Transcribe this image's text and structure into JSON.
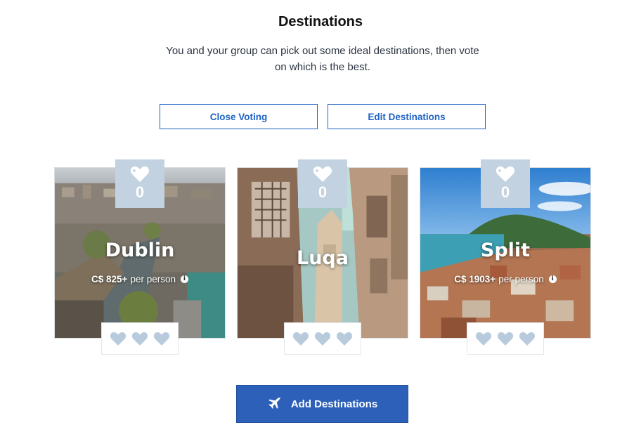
{
  "header": {
    "title": "Destinations",
    "subtitle": "You and your group can pick out some ideal destinations, then vote on which is the best."
  },
  "actions": {
    "close_voting": "Close Voting",
    "edit_destinations": "Edit Destinations",
    "add_destinations": "Add Destinations"
  },
  "destinations": [
    {
      "name": "Dublin",
      "price": "C$ 825+",
      "per": "per person",
      "votes": "0"
    },
    {
      "name": "Luqa",
      "price": "",
      "per": "",
      "votes": "0"
    },
    {
      "name": "Split",
      "price": "C$ 1903+",
      "per": "per person",
      "votes": "0"
    }
  ],
  "icons": {
    "vote": "heart-icon",
    "rating": "heart-icon",
    "add": "airplane-icon",
    "info": "info-icon"
  },
  "colors": {
    "accent": "#1f62c4",
    "primary_button": "#2d61b9",
    "vote_box": "#c2d2e0",
    "heart": "#b8cbdc"
  }
}
